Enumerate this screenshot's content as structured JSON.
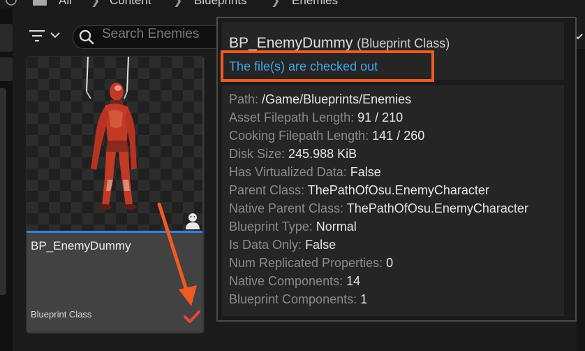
{
  "breadcrumb": {
    "items": [
      "All",
      "Content",
      "Blueprints",
      "Enemies"
    ]
  },
  "search": {
    "placeholder": "Search Enemies"
  },
  "asset": {
    "name": "BP_EnemyDummy",
    "type_label": "Blueprint Class"
  },
  "tooltip": {
    "title": "BP_EnemyDummy",
    "title_suffix": "(Blueprint Class)",
    "status": "The file(s) are checked out",
    "properties": [
      {
        "key": "Path:",
        "value": "/Game/Blueprints/Enemies"
      },
      {
        "key": "Asset Filepath Length:",
        "value": "91 / 210"
      },
      {
        "key": "Cooking Filepath Length:",
        "value": "141 / 260"
      },
      {
        "key": "Disk Size:",
        "value": "245.988 KiB"
      },
      {
        "key": "Has Virtualized Data:",
        "value": "False"
      },
      {
        "key": "Parent Class:",
        "value": "ThePathOfOsu.EnemyCharacter"
      },
      {
        "key": "Native Parent Class:",
        "value": "ThePathOfOsu.EnemyCharacter"
      },
      {
        "key": "Blueprint Type:",
        "value": "Normal"
      },
      {
        "key": "Is Data Only:",
        "value": "False"
      },
      {
        "key": "Num Replicated Properties:",
        "value": "0"
      },
      {
        "key": "Native Components:",
        "value": "14"
      },
      {
        "key": "Blueprint Components:",
        "value": "1"
      }
    ]
  },
  "colors": {
    "accent_blue": "#3e7ee0",
    "status_text": "#3fa7e6",
    "highlight_orange": "#f15a22",
    "checkout_red": "#e8453c"
  },
  "icons": [
    "history-icon",
    "folder-icon",
    "chevron-right-icon",
    "filter-icon",
    "chevron-down-icon",
    "search-icon",
    "actor-icon",
    "checked-out-icon",
    "annotation-arrow"
  ]
}
